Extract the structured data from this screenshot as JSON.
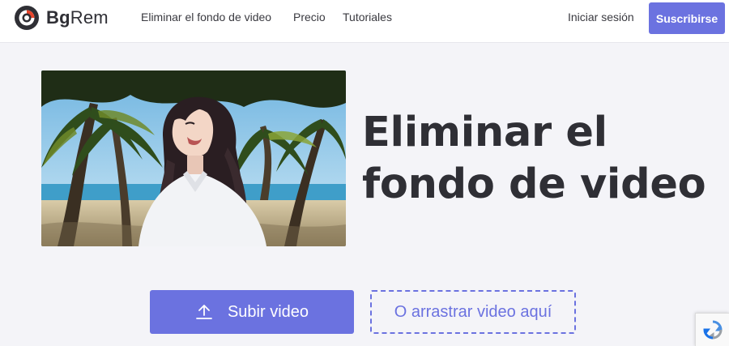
{
  "brand": {
    "name_bold": "Bg",
    "name_regular": "Rem",
    "accent_color": "#6b72e0",
    "logo_ring_colors": [
      "#2f2f35",
      "#e8452c"
    ]
  },
  "nav": {
    "items": [
      {
        "label": "Eliminar el fondo de video"
      },
      {
        "label": "Precio"
      },
      {
        "label": "Tutoriales"
      }
    ],
    "signin_label": "Iniciar sesión",
    "subscribe_label": "Suscribirse"
  },
  "hero": {
    "image_description_icon": "beach-woman-photo",
    "title_line1": "Eliminar el",
    "title_line2": "fondo de video"
  },
  "actions": {
    "upload_label": "Subir video",
    "upload_icon": "upload-icon",
    "drop_label": "O arrastrar video aquí"
  },
  "recaptcha": {
    "icon": "recaptcha-icon"
  }
}
